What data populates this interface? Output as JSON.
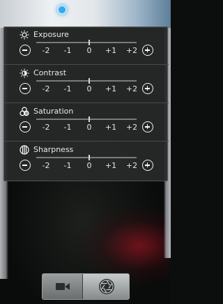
{
  "settings": [
    {
      "title": "Exposure",
      "icon": "exposure-icon",
      "value": 0
    },
    {
      "title": "Contrast",
      "icon": "contrast-icon",
      "value": 0
    },
    {
      "title": "Saturation",
      "icon": "saturation-icon",
      "value": 0
    },
    {
      "title": "Sharpness",
      "icon": "sharpness-icon",
      "value": 0
    }
  ],
  "scale": {
    "min": -2,
    "max": 2,
    "labels": [
      "-2",
      "-1",
      "0",
      "+1",
      "+2"
    ]
  },
  "controls": {
    "video_mode_icon": "video-camera-icon",
    "photo_mode_icon": "camera-shutter-icon",
    "active_mode": "photo"
  },
  "colors": {
    "focus_indicator": "#3aa8e8",
    "panel_background": "#2a2c2c",
    "text": "#e8e8e8"
  }
}
